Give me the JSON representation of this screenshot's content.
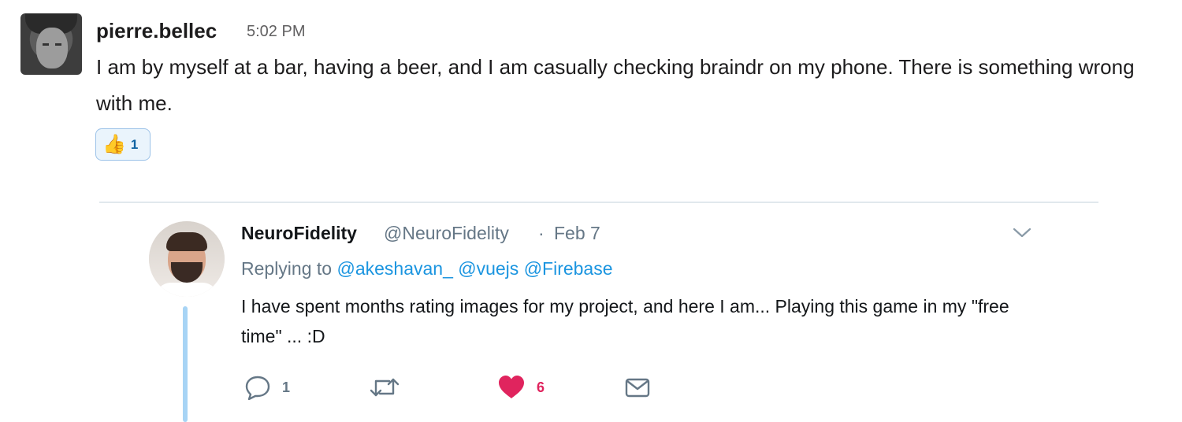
{
  "slack_message": {
    "author": "pierre.bellec",
    "time": "5:02 PM",
    "text": "I am by myself at a bar, having a beer, and I am casually checking braindr on my phone. There is something wrong with me.",
    "reaction": {
      "emoji": "👍",
      "count": "1"
    }
  },
  "tweet": {
    "name": "NeuroFidelity",
    "handle": "@NeuroFidelity",
    "separator": "·",
    "date": "Feb 7",
    "replying_prefix": "Replying to",
    "mentions": [
      "@akeshavan_",
      "@vuejs",
      "@Firebase"
    ],
    "text": "I have spent months rating images for my project, and here I am... Playing this game in my \"free time\" ... :D",
    "actions": {
      "reply_count": "1",
      "like_count": "6"
    }
  },
  "colors": {
    "link": "#1b95e0",
    "like": "#e0245e",
    "secondary_text": "#657786",
    "reaction_border": "#9cc2e8",
    "thread_line": "#a7d4f5"
  },
  "icons": {
    "reply": "reply-icon",
    "retweet": "retweet-icon",
    "like": "heart-icon",
    "dm": "envelope-icon",
    "menu": "chevron-down-icon"
  }
}
